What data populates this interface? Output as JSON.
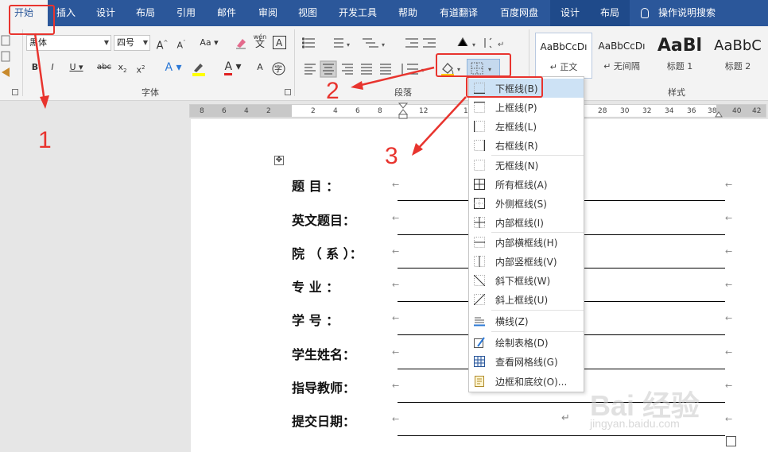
{
  "tabs": [
    {
      "label": "开始",
      "x": 0,
      "w": 60,
      "active": true
    },
    {
      "label": "插入"
    },
    {
      "label": "设计"
    },
    {
      "label": "布局"
    },
    {
      "label": "引用"
    },
    {
      "label": "邮件"
    },
    {
      "label": "审阅"
    },
    {
      "label": "视图"
    },
    {
      "label": "开发工具"
    },
    {
      "label": "帮助"
    },
    {
      "label": "有道翻译"
    },
    {
      "label": "百度网盘"
    },
    {
      "label": "设计"
    },
    {
      "label": "布局"
    }
  ],
  "tell_me": "操作说明搜索",
  "font": {
    "name": "黑体",
    "size": "四号",
    "group_label": "字体"
  },
  "paragraph": {
    "group_label": "段落"
  },
  "styles": {
    "group_label": "样式",
    "items": [
      {
        "sample": "AaBbCcDı",
        "name": "↵ 正文"
      },
      {
        "sample": "AaBbCcDı",
        "name": "↵ 无间隔"
      },
      {
        "sample": "AaBl",
        "name": "标题 1"
      },
      {
        "sample": "AaBbC",
        "name": "标题 2"
      }
    ]
  },
  "ruler": {
    "left_ticks": [
      "8",
      "6",
      "4",
      "2"
    ],
    "right_ticks": [
      "2",
      "4",
      "6",
      "8",
      "12",
      "1",
      "28",
      "30",
      "32",
      "34",
      "36",
      "38",
      "40",
      "42"
    ]
  },
  "form_rows": [
    {
      "label": "题    目   ："
    },
    {
      "label": "英文题目："
    },
    {
      "label": "院 （ 系 ）："
    },
    {
      "label": "专    业   ："
    },
    {
      "label": "学    号   ："
    },
    {
      "label": "学生姓名："
    },
    {
      "label": "指导教师："
    },
    {
      "label": "提交日期："
    }
  ],
  "border_menu": {
    "items": [
      {
        "label": "下框线(B)",
        "icon": "bottom-border-icon",
        "highlighted": true
      },
      {
        "label": "上框线(P)",
        "icon": "top-border-icon"
      },
      {
        "label": "左框线(L)",
        "icon": "left-border-icon"
      },
      {
        "label": "右框线(R)",
        "icon": "right-border-icon"
      },
      {
        "label": "无框线(N)",
        "icon": "no-border-icon"
      },
      {
        "label": "所有框线(A)",
        "icon": "all-borders-icon"
      },
      {
        "label": "外侧框线(S)",
        "icon": "outside-borders-icon"
      },
      {
        "label": "内部框线(I)",
        "icon": "inside-borders-icon"
      },
      {
        "label": "内部横框线(H)",
        "icon": "inside-horizontal-border-icon"
      },
      {
        "label": "内部竖框线(V)",
        "icon": "inside-vertical-border-icon"
      },
      {
        "label": "斜下框线(W)",
        "icon": "diagonal-down-border-icon"
      },
      {
        "label": "斜上框线(U)",
        "icon": "diagonal-up-border-icon"
      },
      {
        "label": "横线(Z)",
        "icon": "horizontal-line-icon"
      },
      {
        "label": "绘制表格(D)",
        "icon": "draw-table-icon"
      },
      {
        "label": "查看网格线(G)",
        "icon": "view-gridlines-icon"
      },
      {
        "label": "边框和底纹(O)...",
        "icon": "borders-shading-icon"
      }
    ]
  },
  "annotations": [
    "1",
    "2",
    "3"
  ],
  "watermark": {
    "main": "Bai 经验",
    "sub": "jingyan.baidu.com"
  },
  "colors": {
    "ribbon_blue": "#2b579a",
    "annotation_red": "#e8342e",
    "menu_highlight": "#cde2f5"
  }
}
